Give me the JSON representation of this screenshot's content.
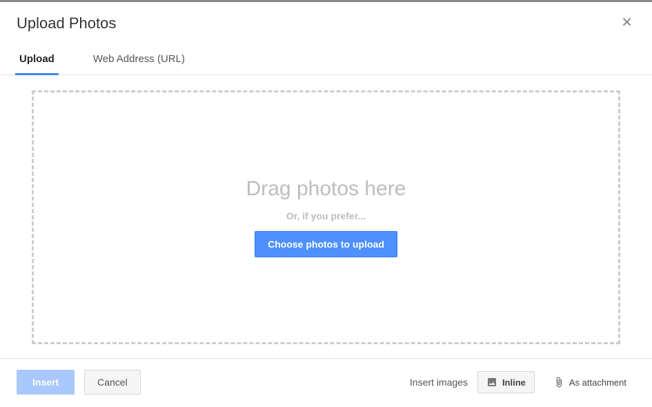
{
  "header": {
    "title": "Upload Photos"
  },
  "tabs": {
    "upload": "Upload",
    "url": "Web Address (URL)"
  },
  "dropzone": {
    "drag_text": "Drag photos here",
    "or_text": "Or, if you prefer...",
    "choose_button": "Choose photos to upload"
  },
  "footer": {
    "insert": "Insert",
    "cancel": "Cancel",
    "insert_images_label": "Insert images",
    "inline": "Inline",
    "as_attachment": "As attachment"
  }
}
